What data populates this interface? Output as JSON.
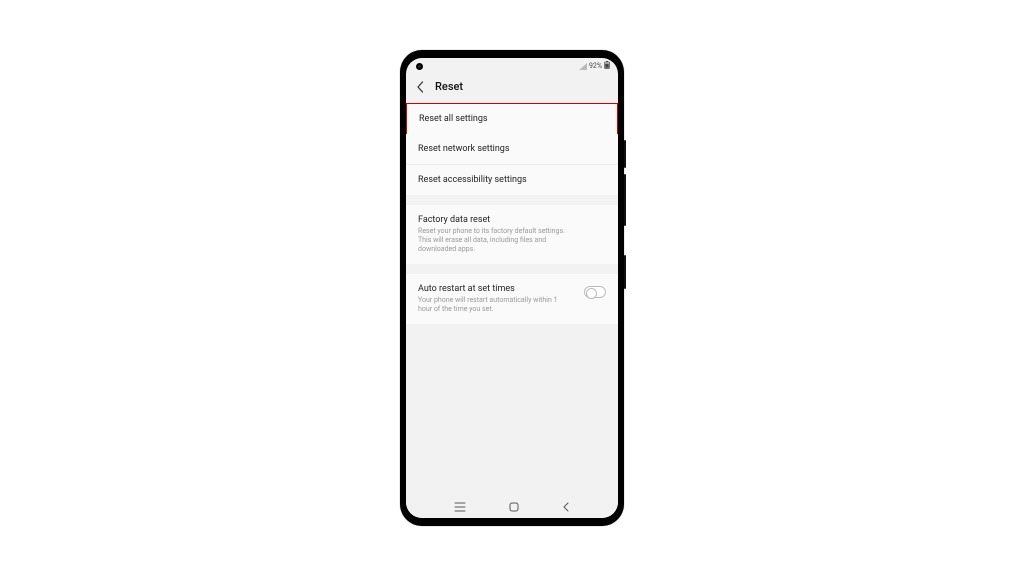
{
  "status": {
    "battery_text": "92%"
  },
  "header": {
    "title": "Reset"
  },
  "items": {
    "reset_all": "Reset all settings",
    "reset_network": "Reset network settings",
    "reset_accessibility": "Reset accessibility settings",
    "factory_title": "Factory data reset",
    "factory_sub": "Reset your phone to its factory default settings. This will erase all data, including files and downloaded apps.",
    "auto_restart_title": "Auto restart at set times",
    "auto_restart_sub": "Your phone will restart automatically within 1 hour of the time you set."
  }
}
